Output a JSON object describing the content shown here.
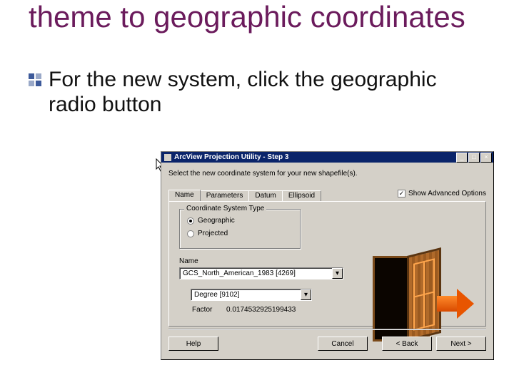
{
  "slide": {
    "title": "theme to geographic coordinates",
    "bullet": "For the new system, click the geographic radio button"
  },
  "wizard": {
    "window_title": "ArcView Projection Utility - Step 3",
    "titlebar_buttons": {
      "min": "_",
      "max": "□",
      "close": "×"
    },
    "instruction": "Select the new coordinate system for your new shapefile(s).",
    "show_advanced_label": "Show Advanced Options",
    "show_advanced_checked": true,
    "tabs": [
      "Name",
      "Parameters",
      "Datum",
      "Ellipsoid"
    ],
    "active_tab": 0,
    "coord_group_legend": "Coordinate System Type",
    "radios": {
      "geographic": {
        "label": "Geographic",
        "selected": true
      },
      "projected": {
        "label": "Projected",
        "selected": false
      }
    },
    "name_label": "Name",
    "name_value": "GCS_North_American_1983 [4269]",
    "unit_value": "Degree [9102]",
    "factor_label": "Factor",
    "factor_value": "0.0174532925199433",
    "buttons": {
      "help": "Help",
      "cancel": "Cancel",
      "back": "< Back",
      "next": "Next >"
    },
    "dropdown_glyph": "▾",
    "check_glyph": "✓"
  }
}
